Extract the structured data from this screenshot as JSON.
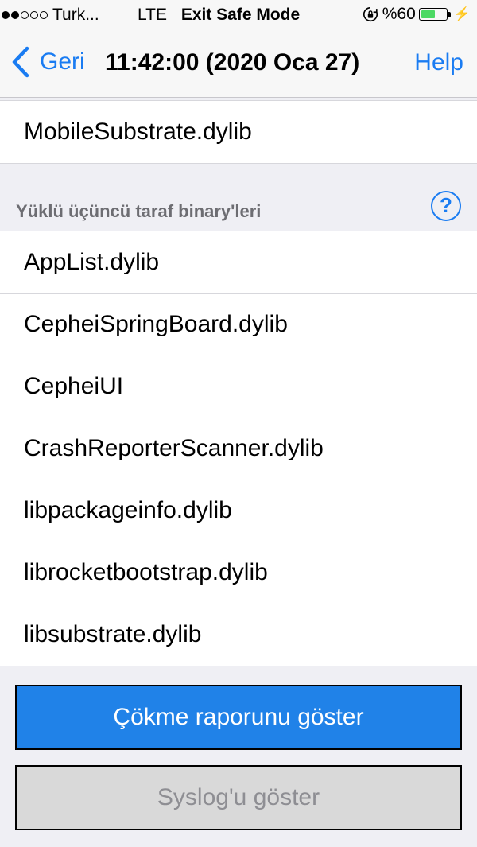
{
  "status_bar": {
    "carrier": "Turk...",
    "network": "LTE",
    "mode": "Exit Safe Mode",
    "battery_percent": "%60",
    "battery_level": 0.6,
    "battery_color": "#4cd964"
  },
  "nav": {
    "back_label": "Geri",
    "title": "11:42:00 (2020 Oca 27)",
    "help_label": "Help"
  },
  "top_group": {
    "items": [
      "MobileSubstrate.dylib"
    ]
  },
  "third_party": {
    "header": "Yüklü üçüncü taraf binary'leri",
    "help_glyph": "?",
    "items": [
      "AppList.dylib",
      "CepheiSpringBoard.dylib",
      "CepheiUI",
      "CrashReporterScanner.dylib",
      "libpackageinfo.dylib",
      "librocketbootstrap.dylib",
      "libsubstrate.dylib"
    ]
  },
  "buttons": {
    "show_crash_report": "Çökme raporunu göster",
    "show_syslog": "Syslog'u göster"
  },
  "colors": {
    "accent": "#1a7cf2",
    "primary_button": "#2082e8",
    "disabled_button": "#d9d9d9"
  }
}
